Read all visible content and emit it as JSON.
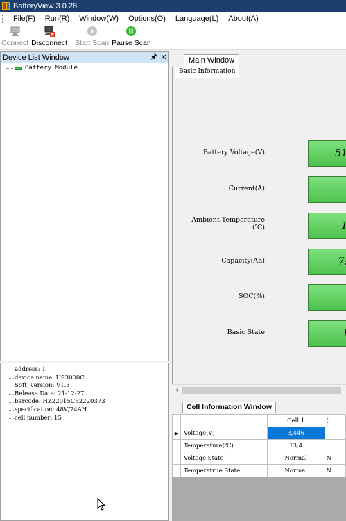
{
  "window": {
    "title": "BatteryView 3.0.28"
  },
  "menu": [
    "File(F)",
    "Run(R)",
    "Window(W)",
    "Options(O)",
    "Language(L)",
    "About(A)"
  ],
  "toolbar": {
    "connect": "Connect",
    "disconnect": "Disconnect",
    "start_scan": "Start Scan",
    "pause_scan": "Pause Scan"
  },
  "device_list": {
    "title": "Device List Window",
    "pin_icon": "pin-icon",
    "close_icon": "close-icon",
    "items": [
      "Battery Module"
    ]
  },
  "device_info": [
    "address: 1",
    "device name: US3000C",
    "Soft  version: V1.3",
    "Release Date: 21-12-27",
    "barcode: HZ22015C32220373",
    "specification: 48V/74AH",
    "cell number: 15"
  ],
  "main": {
    "tab": "Main Window",
    "subtab": "Basic Information",
    "fields": [
      {
        "label": "Battery Voltage(V)",
        "value": "51"
      },
      {
        "label": "Current(A)",
        "value": ""
      },
      {
        "label": "Ambient Temperature (℃)",
        "value": "1"
      },
      {
        "label": "Capacity(Ah)",
        "value": "7:"
      },
      {
        "label": "SOC(%)",
        "value": ""
      },
      {
        "label": "Basic State",
        "value": "I"
      }
    ]
  },
  "cell_info": {
    "tab": "Cell Information Window",
    "columns": [
      "Cell 1",
      "("
    ],
    "rows": [
      {
        "name": "Voltage(V)",
        "cell1": "3,446",
        "cell2": ""
      },
      {
        "name": "Temperature(℃)",
        "cell1": "13,4",
        "cell2": ""
      },
      {
        "name": "Voltage State",
        "cell1": "Normal",
        "cell2": "N"
      },
      {
        "name": "Temperatrue State",
        "cell1": "Normal",
        "cell2": "N"
      }
    ]
  }
}
